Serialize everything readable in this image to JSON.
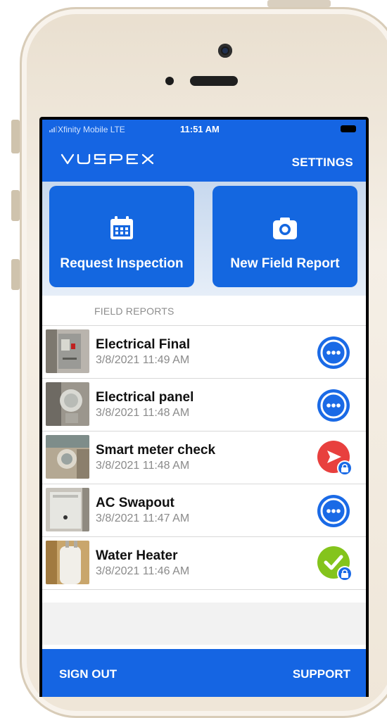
{
  "status_bar": {
    "carrier": "Xfinity Mobile  LTE",
    "time": "11:51 AM"
  },
  "header": {
    "logo_text": "VUSPEX",
    "settings_label": "SETTINGS"
  },
  "tiles": [
    {
      "label": "Request Inspection",
      "icon": "calendar-icon"
    },
    {
      "label": "New Field Report",
      "icon": "camera-icon"
    }
  ],
  "field_reports": {
    "section_title": "FIELD REPORTS",
    "items": [
      {
        "title": "Electrical Final",
        "date": "3/8/2021 11:49 AM",
        "status_icon": "more-icon",
        "thumb": "electrical-box-thumbnail"
      },
      {
        "title": "Electrical panel",
        "date": "3/8/2021 11:48 AM",
        "status_icon": "more-icon",
        "thumb": "electric-meter-thumbnail"
      },
      {
        "title": "Smart meter check",
        "date": "3/8/2021 11:48 AM",
        "status_icon": "send-locked-icon",
        "thumb": "meter-check-thumbnail"
      },
      {
        "title": "AC Swapout",
        "date": "3/8/2021 11:47 AM",
        "status_icon": "more-icon",
        "thumb": "ac-unit-thumbnail"
      },
      {
        "title": "Water Heater",
        "date": "3/8/2021 11:46 AM",
        "status_icon": "check-locked-icon",
        "thumb": "water-heater-thumbnail"
      }
    ]
  },
  "footer": {
    "sign_out_label": "SIGN OUT",
    "support_label": "SUPPORT"
  },
  "colors": {
    "primary": "#1565e3",
    "more_icon": "#1a6ae6",
    "send": "#e8403e",
    "done": "#84c41c"
  }
}
